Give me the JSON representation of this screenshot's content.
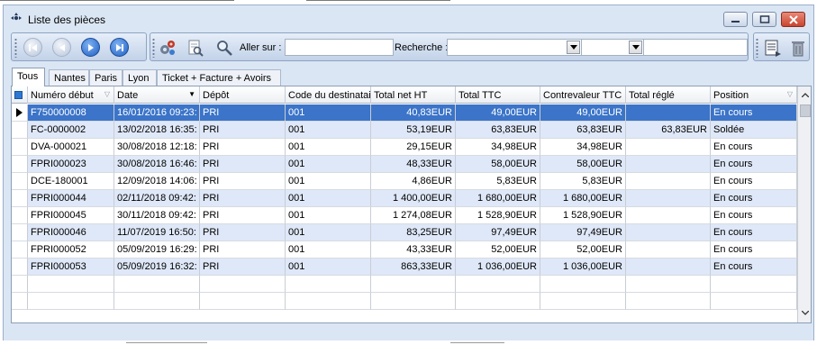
{
  "window": {
    "title": "Liste des pièces",
    "controls": [
      "minimize",
      "maximize",
      "close"
    ]
  },
  "toolbar": {
    "nav_buttons": [
      "first-icon",
      "previous-icon",
      "next-icon",
      "last-icon"
    ],
    "tool_icons": [
      "settings-gears-icon",
      "search-document-icon",
      "magnifier-icon"
    ],
    "goto_label": "Aller sur :",
    "goto_value": "",
    "search_label": "Recherche :",
    "search_field1": "",
    "search_field2": "",
    "search_value": "",
    "right_icons": [
      "list-report-icon",
      "delete-bin-icon"
    ]
  },
  "tabs": [
    {
      "label": "Tous",
      "active": true
    },
    {
      "label": "Nantes",
      "active": false
    },
    {
      "label": "Paris",
      "active": false
    },
    {
      "label": "Lyon",
      "active": false
    },
    {
      "label": "Ticket + Facture + Avoirs",
      "active": false
    }
  ],
  "grid": {
    "columns": [
      "Numéro début",
      "Date",
      "Dépôt",
      "Code du destinatai",
      "Total net HT",
      "Total TTC",
      "Contrevaleur TTC",
      "Total réglé",
      "Position"
    ],
    "rows": [
      [
        "F750000008",
        "16/01/2016 09:23:",
        "PRI",
        "001",
        "40,83EUR",
        "49,00EUR",
        "49,00EUR",
        "",
        "En cours"
      ],
      [
        "FC-0000002",
        "13/02/2018 16:35:",
        "PRI",
        "001",
        "53,19EUR",
        "63,83EUR",
        "63,83EUR",
        "63,83EUR",
        "Soldée"
      ],
      [
        "DVA-000021",
        "30/08/2018 12:18:",
        "PRI",
        "001",
        "29,15EUR",
        "34,98EUR",
        "34,98EUR",
        "",
        "En cours"
      ],
      [
        "FPRI000023",
        "30/08/2018 16:46:",
        "PRI",
        "001",
        "48,33EUR",
        "58,00EUR",
        "58,00EUR",
        "",
        "En cours"
      ],
      [
        "DCE-180001",
        "12/09/2018 14:06:",
        "PRI",
        "001",
        "4,86EUR",
        "5,83EUR",
        "5,83EUR",
        "",
        "En cours"
      ],
      [
        "FPRI000044",
        "02/11/2018 09:42:",
        "PRI",
        "001",
        "1 400,00EUR",
        "1 680,00EUR",
        "1 680,00EUR",
        "",
        "En cours"
      ],
      [
        "FPRI000045",
        "30/11/2018 09:42:",
        "PRI",
        "001",
        "1 274,08EUR",
        "1 528,90EUR",
        "1 528,90EUR",
        "",
        "En cours"
      ],
      [
        "FPRI000046",
        "11/07/2019 16:50:",
        "PRI",
        "001",
        "83,25EUR",
        "97,49EUR",
        "97,49EUR",
        "",
        "En cours"
      ],
      [
        "FPRI000052",
        "05/09/2019 16:29:",
        "PRI",
        "001",
        "43,33EUR",
        "52,00EUR",
        "52,00EUR",
        "",
        "En cours"
      ],
      [
        "FPRI000053",
        "05/09/2019 16:32:",
        "PRI",
        "001",
        "863,33EUR",
        "1 036,00EUR",
        "1 036,00EUR",
        "",
        "En cours"
      ]
    ],
    "selected_row": 0,
    "sorted_column": "Date"
  },
  "colors": {
    "selection": "#3b74c8",
    "alt_row": "#dfe8f8",
    "window_bg": "#dbe6f4"
  }
}
